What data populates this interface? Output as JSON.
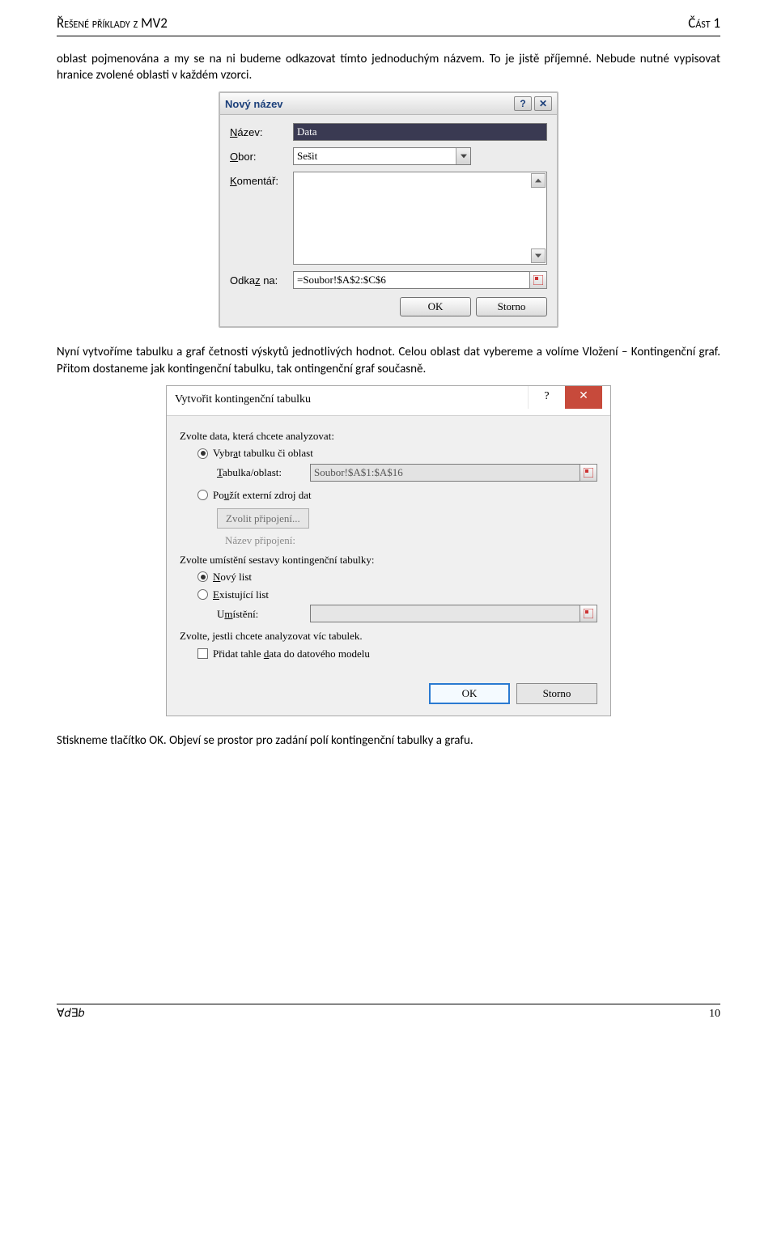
{
  "header": {
    "left": "Řešené příklady z MV2",
    "right": "Část 1"
  },
  "para1": "oblast pojmenována a my se na ni budeme odkazovat tímto jednoduchým názvem. To je jistě příjemné. Nebude nutné vypisovat hranice zvolené oblasti v každém vzorci.",
  "dlg1": {
    "title": "Nový název",
    "help_glyph": "?",
    "close_glyph": "✕",
    "name_label": "Název:",
    "name_value": "Data",
    "scope_label": "Obor:",
    "scope_value": "Sešit",
    "comment_label": "Komentář:",
    "ref_label": "Odkaz na:",
    "ref_value": "=Soubor!$A$2:$C$6",
    "ok": "OK",
    "cancel": "Storno"
  },
  "para2": "Nyní vytvoříme tabulku a graf četnosti výskytů jednotlivých hodnot. Celou oblast dat vybereme a volíme Vložení – Kontingenční graf. Přitom dostaneme jak kontingenční tabulku, tak ontingenční graf současně.",
  "dlg2": {
    "title": "Vytvořit kontingenční tabulku",
    "help_glyph": "?",
    "close_glyph": "✕",
    "sec_choose": "Zvolte data, která chcete analyzovat:",
    "r_table": "Vybrat tabulku či oblast",
    "tab_label": "Tabulka/oblast:",
    "tab_value": "Soubor!$A$1:$A$16",
    "r_ext": "Použít externí zdroj dat",
    "choose_conn": "Zvolit připojení...",
    "conn_label": "Název připojení:",
    "sec_place": "Zvolte umístění sestavy kontingenční tabulky:",
    "r_new": "Nový list",
    "r_exist": "Existující list",
    "loc_label": "Umístění:",
    "sec_multi": "Zvolte, jestli chcete analyzovat víc tabulek.",
    "chk_model": "Přidat tahle data do datového modelu",
    "ok": "OK",
    "cancel": "Storno"
  },
  "para3": "Stiskneme tlačítko OK. Objeví se prostor pro zadání polí kontingenční tabulky a grafu.",
  "footer": {
    "left": "∀𝑑∃𝑏",
    "right": "10"
  }
}
